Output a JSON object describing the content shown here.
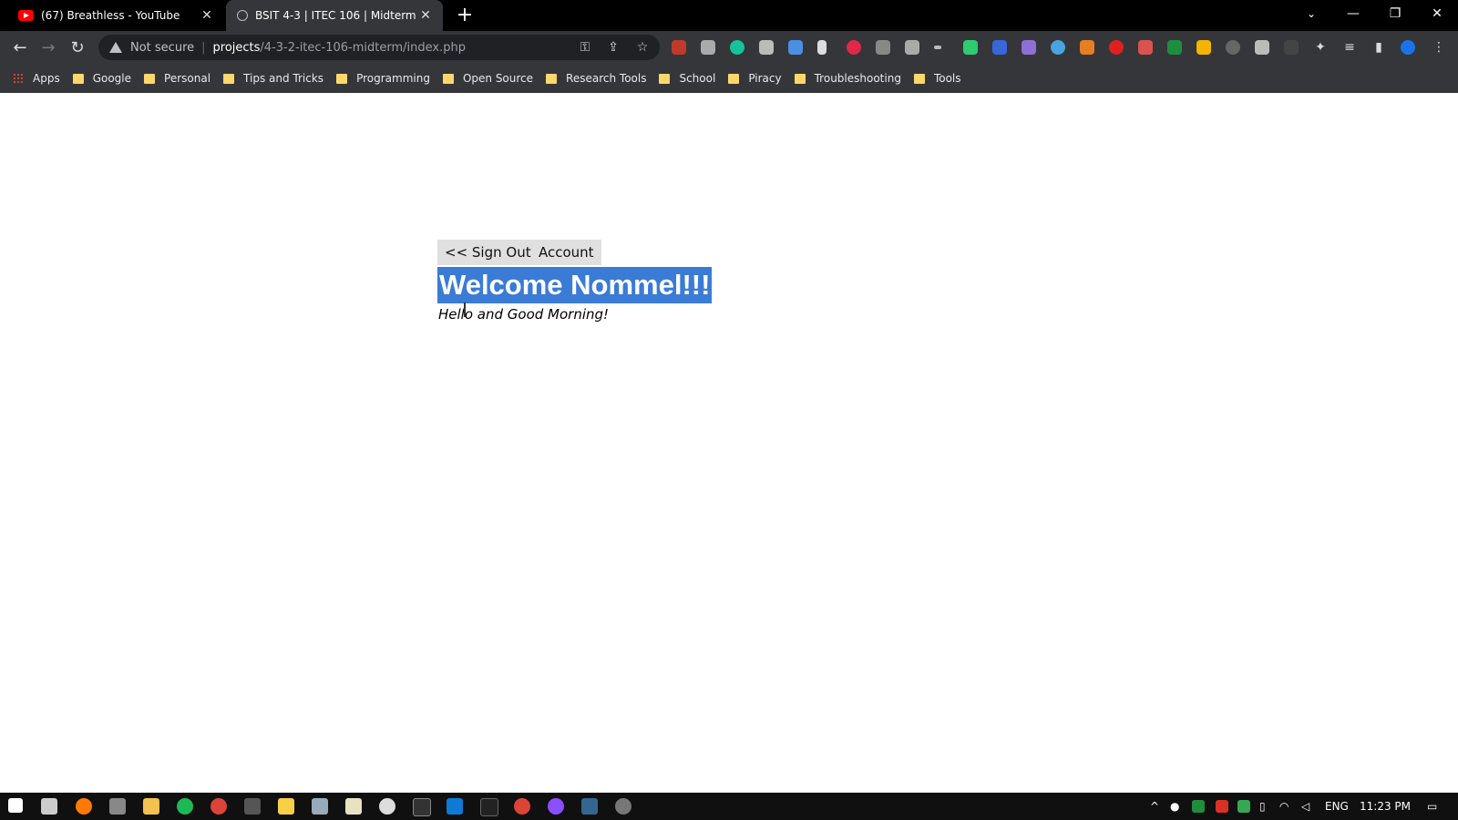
{
  "tabs": [
    {
      "title": "(67) Breathless - YouTube",
      "icon": "youtube-icon"
    },
    {
      "title": "BSIT 4-3 | ITEC 106 | Midterm",
      "icon": "globe-icon"
    }
  ],
  "address_bar": {
    "security_label": "Not secure",
    "host": "projects",
    "path": "/4-3-2-itec-106-midterm/index.php"
  },
  "bookmarks": [
    "Apps",
    "Google",
    "Personal",
    "Tips and Tricks",
    "Programming",
    "Open Source",
    "Research Tools",
    "School",
    "Piracy",
    "Troubleshooting",
    "Tools"
  ],
  "page": {
    "sign_out_label": "<< Sign Out",
    "account_label": "Account",
    "heading": "Welcome Nommel!!!",
    "greeting": "Hello and Good Morning!"
  },
  "taskbar": {
    "language": "ENG",
    "time": "11:23 PM"
  },
  "colors": {
    "selection": "#3a7bd5",
    "chrome_dark": "#35363a"
  }
}
